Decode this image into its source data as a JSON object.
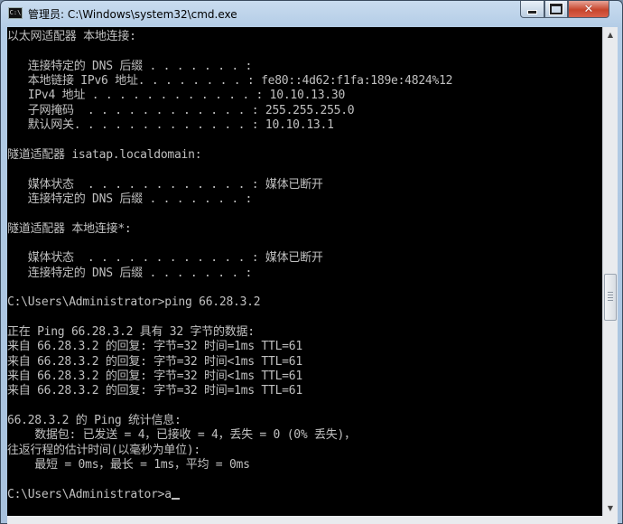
{
  "window": {
    "title": "管理员: C:\\Windows\\system32\\cmd.exe",
    "icon_label": "C:\\",
    "controls": {
      "minimize": "minimize-icon",
      "maximize": "maximize-icon",
      "close": "close-icon",
      "close_glyph": "✕"
    }
  },
  "console": {
    "lines": [
      "以太网适配器 本地连接:",
      "",
      "   连接特定的 DNS 后缀 . . . . . . . :",
      "   本地链接 IPv6 地址. . . . . . . . : fe80::4d62:f1fa:189e:4824%12",
      "   IPv4 地址 . . . . . . . . . . . . : 10.10.13.30",
      "   子网掩码  . . . . . . . . . . . . : 255.255.255.0",
      "   默认网关. . . . . . . . . . . . . : 10.10.13.1",
      "",
      "隧道适配器 isatap.localdomain:",
      "",
      "   媒体状态  . . . . . . . . . . . . : 媒体已断开",
      "   连接特定的 DNS 后缀 . . . . . . . :",
      "",
      "隧道适配器 本地连接*:",
      "",
      "   媒体状态  . . . . . . . . . . . . : 媒体已断开",
      "   连接特定的 DNS 后缀 . . . . . . . :",
      "",
      "C:\\Users\\Administrator>ping 66.28.3.2",
      "",
      "正在 Ping 66.28.3.2 具有 32 字节的数据:",
      "来自 66.28.3.2 的回复: 字节=32 时间=1ms TTL=61",
      "来自 66.28.3.2 的回复: 字节=32 时间<1ms TTL=61",
      "来自 66.28.3.2 的回复: 字节=32 时间<1ms TTL=61",
      "来自 66.28.3.2 的回复: 字节=32 时间=1ms TTL=61",
      "",
      "66.28.3.2 的 Ping 统计信息:",
      "    数据包: 已发送 = 4，已接收 = 4，丢失 = 0 (0% 丢失)，",
      "往返行程的估计时间(以毫秒为单位):",
      "    最短 = 0ms，最长 = 1ms，平均 = 0ms",
      "",
      "C:\\Users\\Administrator>a"
    ]
  },
  "scrollbar": {
    "up_icon": "▲",
    "down_icon": "▼"
  },
  "colors": {
    "console_bg": "#000000",
    "console_fg": "#c0c0c0",
    "close_button": "#c7452c"
  }
}
